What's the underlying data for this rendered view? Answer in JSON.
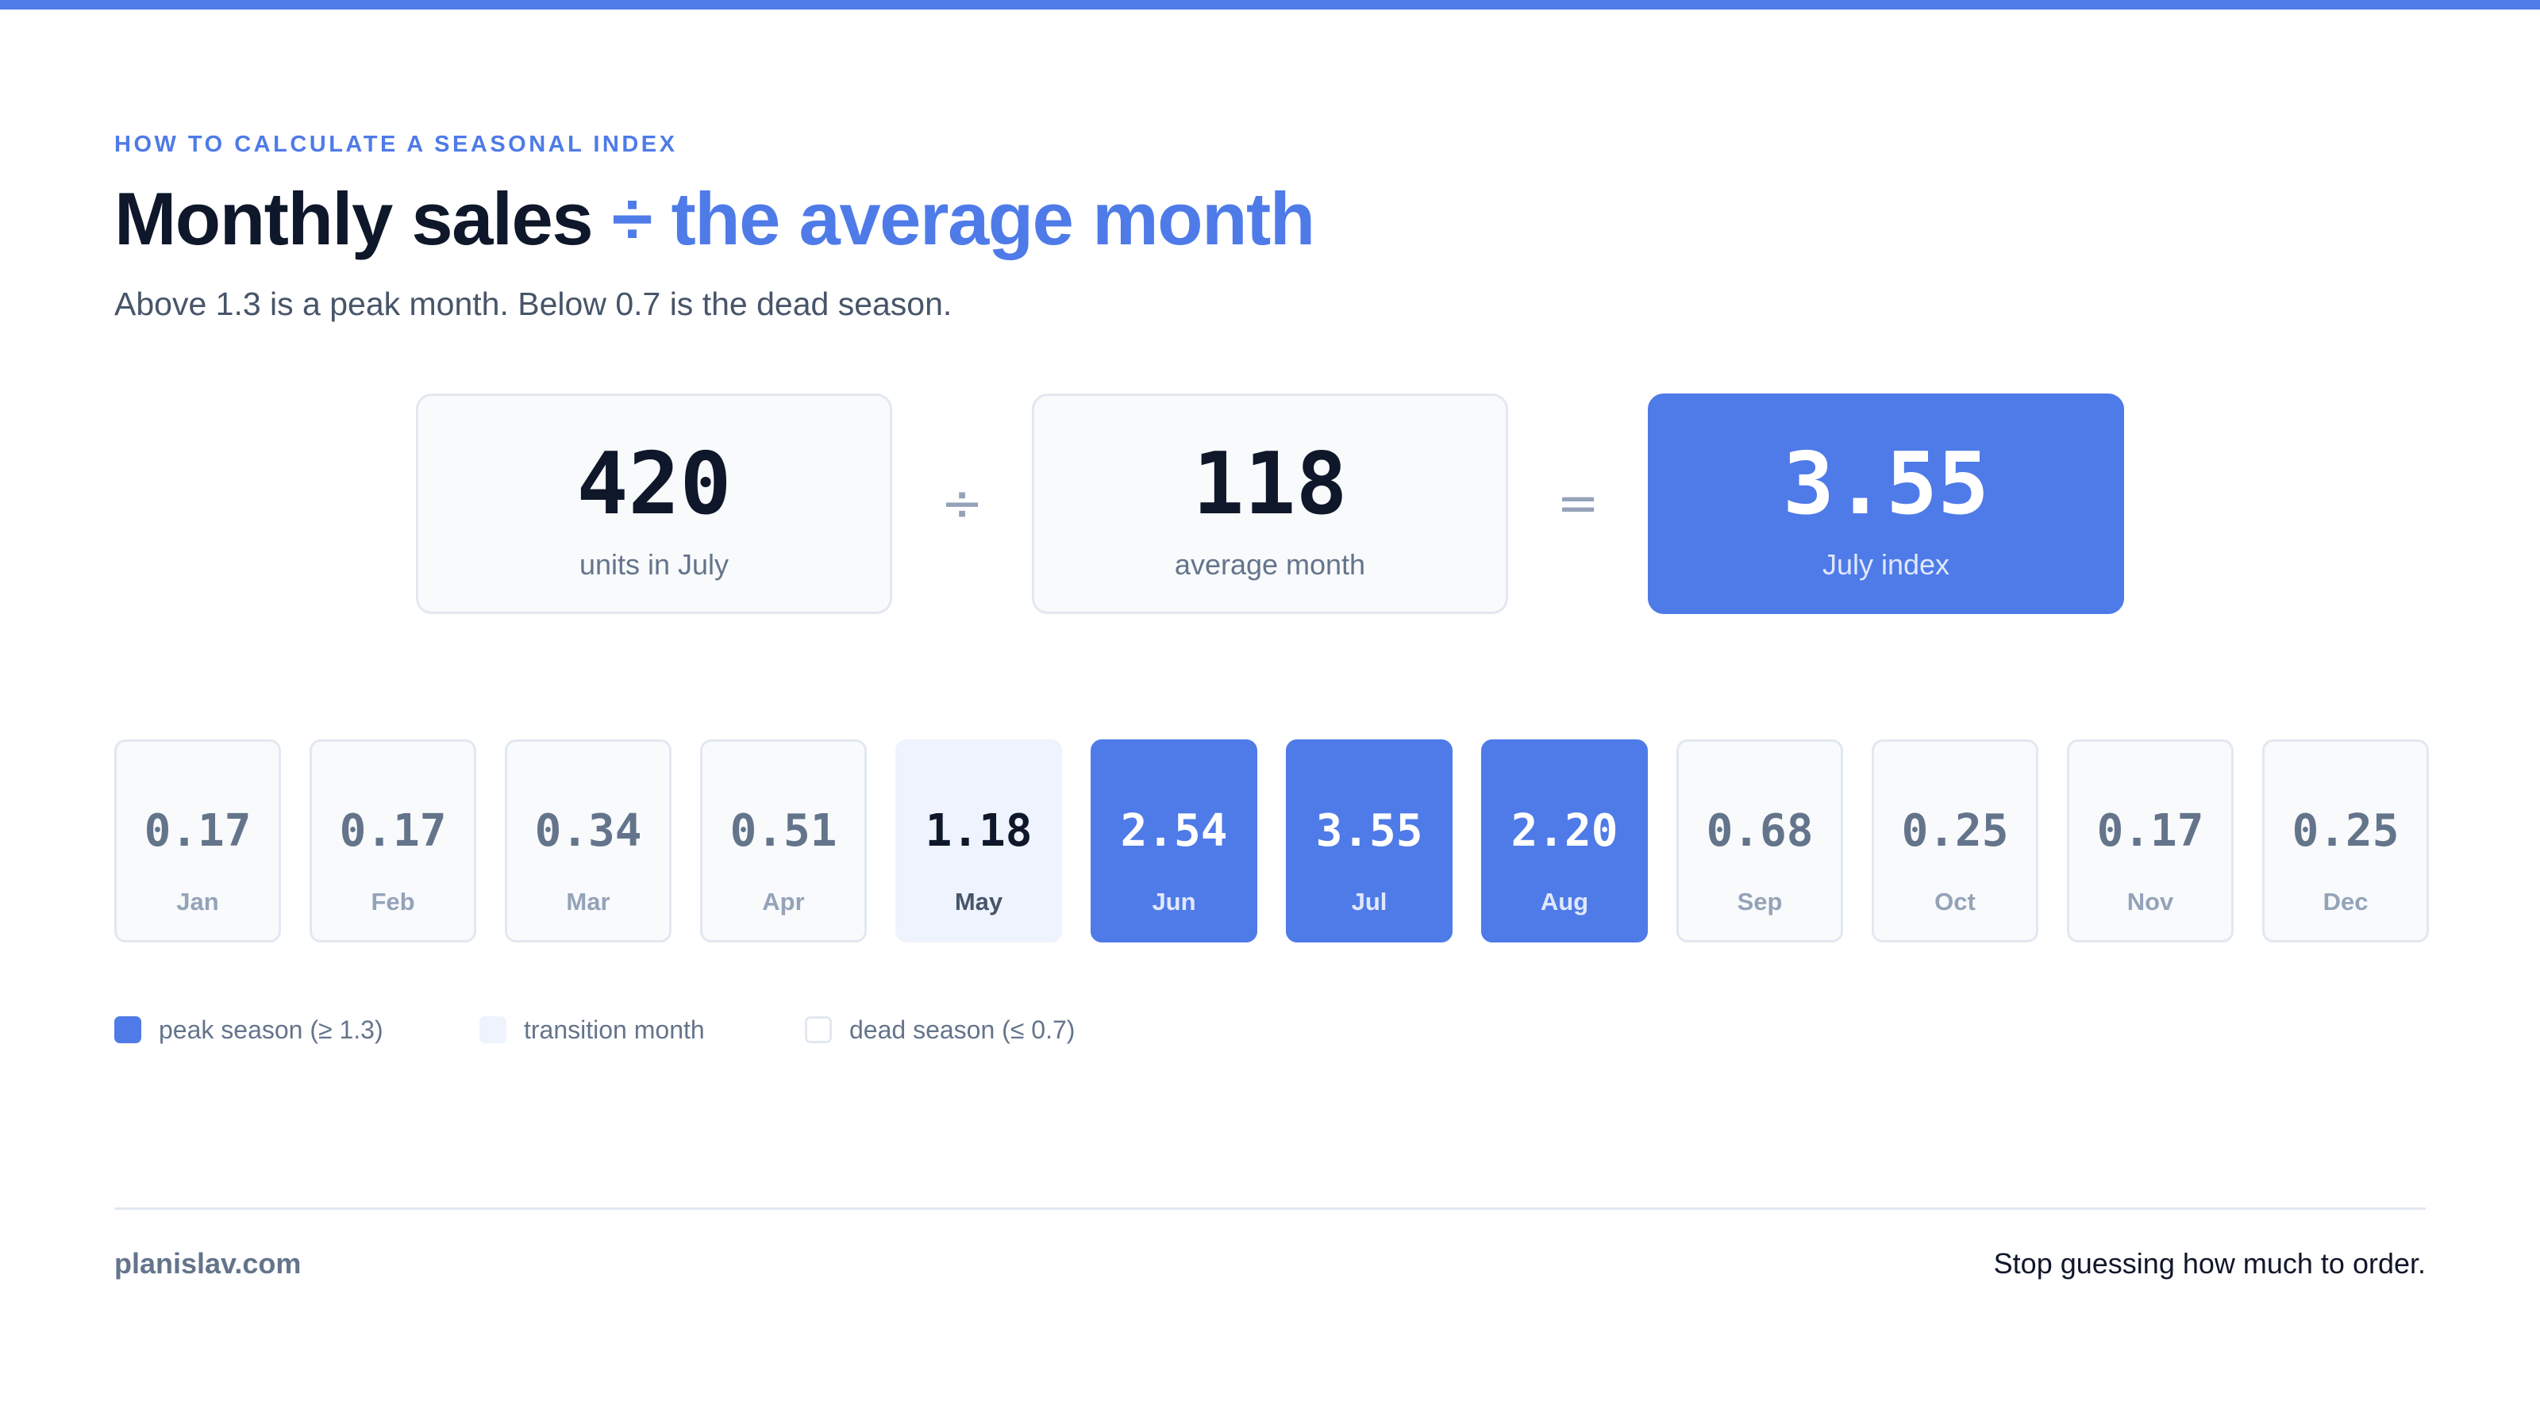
{
  "header": {
    "eyebrow": "HOW TO CALCULATE A SEASONAL INDEX",
    "title_main": "Monthly sales",
    "title_accent": "÷ the average month",
    "subtitle": "Above 1.3 is a peak month. Below 0.7 is the dead season."
  },
  "formula": {
    "numerator": {
      "value": "420",
      "label": "units in July"
    },
    "divide_symbol": "÷",
    "denominator": {
      "value": "118",
      "label": "average month"
    },
    "equals_symbol": "=",
    "result": {
      "value": "3.55",
      "label": "July index"
    }
  },
  "months": [
    {
      "name": "Jan",
      "index": "0.17",
      "category": "dead"
    },
    {
      "name": "Feb",
      "index": "0.17",
      "category": "dead"
    },
    {
      "name": "Mar",
      "index": "0.34",
      "category": "dead"
    },
    {
      "name": "Apr",
      "index": "0.51",
      "category": "dead"
    },
    {
      "name": "May",
      "index": "1.18",
      "category": "transition"
    },
    {
      "name": "Jun",
      "index": "2.54",
      "category": "peak"
    },
    {
      "name": "Jul",
      "index": "3.55",
      "category": "peak"
    },
    {
      "name": "Aug",
      "index": "2.20",
      "category": "peak"
    },
    {
      "name": "Sep",
      "index": "0.68",
      "category": "dead"
    },
    {
      "name": "Oct",
      "index": "0.25",
      "category": "dead"
    },
    {
      "name": "Nov",
      "index": "0.17",
      "category": "dead"
    },
    {
      "name": "Dec",
      "index": "0.25",
      "category": "dead"
    }
  ],
  "legend": {
    "peak": "peak season (≥ 1.3)",
    "transition": "transition month",
    "dead": "dead season (≤ 0.7)"
  },
  "footer": {
    "site": "planislav.com",
    "tagline": "Stop guessing how much to order."
  },
  "colors": {
    "accent": "#4f7be8",
    "transition": "#eef3fd",
    "card_bg": "#f8fafc",
    "border": "#e2e8f0",
    "ink": "#0f172a",
    "muted": "#64748b"
  }
}
